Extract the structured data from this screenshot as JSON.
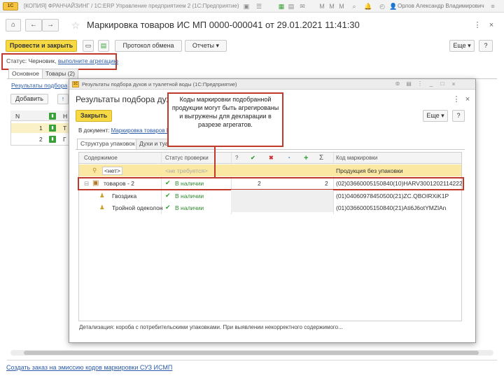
{
  "window": {
    "logo": "1C",
    "title": "[КОПИЯ] ФРАНЧАЙЗИНГ / 1С:ERP Управление предприятием 2 (1С:Предприятие)",
    "user": "Орлов Александр Владимирович"
  },
  "document": {
    "title": "Маркировка товаров ИС МП 0000-000041 от 29.01.2021 11:41:30",
    "toolbar": {
      "post_close": "Провести и закрыть",
      "exchange_log": "Протокол обмена",
      "reports": "Отчеты",
      "more": "Еще",
      "help": "?"
    },
    "status_label": "Статус:",
    "status_value": "Черновик,",
    "status_action": "выполните агрегацию",
    "tabs": [
      "Основное",
      "Товары (2)"
    ],
    "results_link": "Результаты подбора",
    "add_button": "Добавить",
    "table": {
      "col_n": "N",
      "rows": [
        {
          "n": "1"
        },
        {
          "n": "2"
        }
      ]
    },
    "bottom_link": "Создать заказ на эмиссию кодов маркировки СУЗ ИСМП"
  },
  "dialog": {
    "window_title": "Результаты подбора духов и туалетной воды (1С:Предприятие)",
    "heading": "Результаты подбора духов и туалетной воды",
    "close_button": "Закрыть",
    "more": "Еще",
    "help": "?",
    "doc_label": "В документ:",
    "doc_link": "Маркировка товаров ИС МП 0000-000041 от 29.01.2021 11:41:30",
    "tabs": [
      "Структура упаковок",
      "Духи и туалетная вода (2)"
    ],
    "columns": {
      "content": "Содержимое",
      "status": "Статус проверки",
      "q": "?",
      "sum": "Σ",
      "code": "Код маркировки"
    },
    "rows": [
      {
        "content": "<нет>",
        "status": "<не требуется>",
        "q": "",
        "sum": "",
        "code": "Продукция без упаковки"
      },
      {
        "content": "товаров - 2",
        "status": "В наличии",
        "q": "2",
        "sum": "2",
        "code": "(02)03660005150840(10)HARV3001202114222"
      },
      {
        "content": "Гвоздика",
        "status": "В наличии",
        "q": "",
        "sum": "",
        "code": "(01)04060978450500(21)ZC.QBOIRXiK1P"
      },
      {
        "content": "Тройной одеколон",
        "status": "В наличии",
        "q": "",
        "sum": "",
        "code": "(01)03660005150840(21)Ati6J6otYMZlAn"
      }
    ],
    "detail": "Детализация: короба с потребительскими упаковками. При выявлении некорректного содержимого..."
  },
  "callout": {
    "text": "Коды маркировки подобранной продукции могут быть агрегированы и выгружены для декларации в разрезе агрегатов."
  },
  "colors": {
    "accent_yellow": "#f7d944",
    "highlight_red": "#c0392b",
    "link_blue": "#2a5aa8",
    "ok_green": "#2e9e2e"
  }
}
